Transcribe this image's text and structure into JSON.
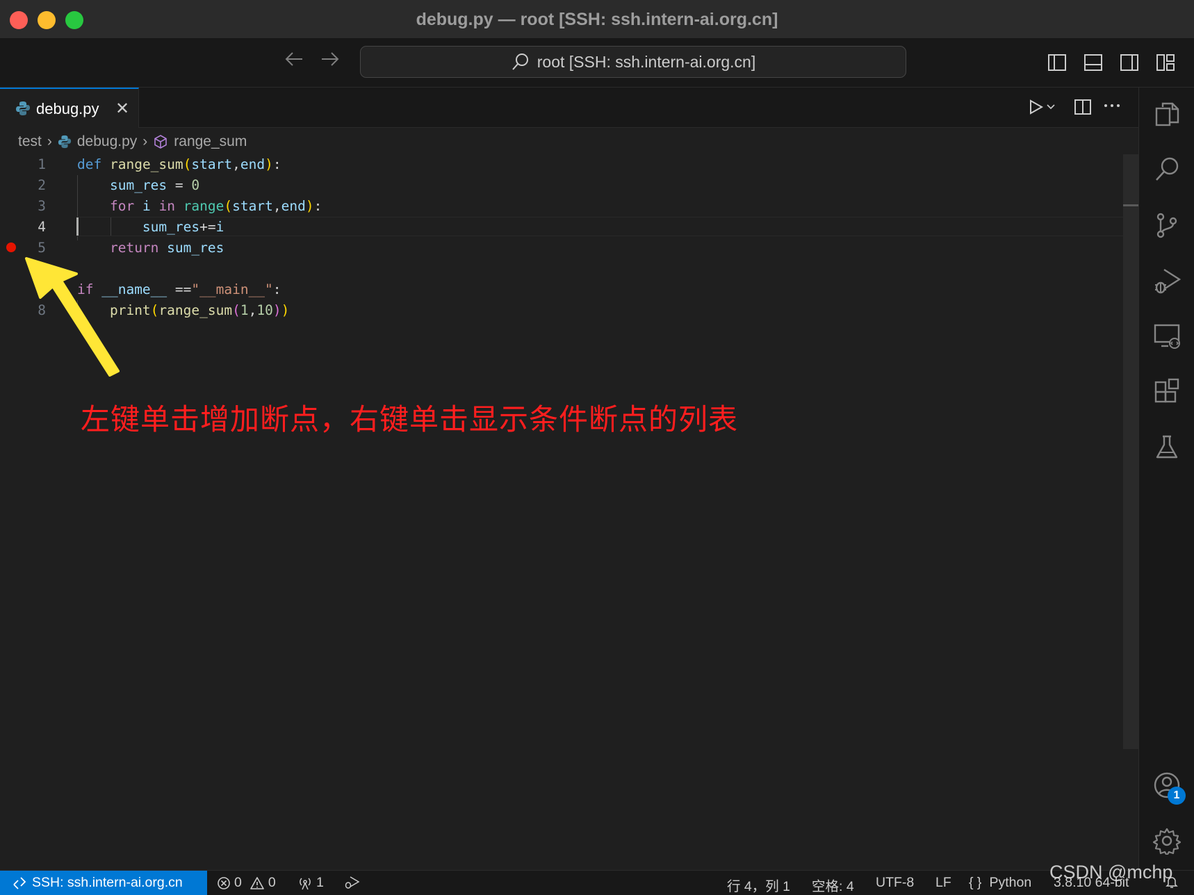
{
  "window": {
    "title": "debug.py — root [SSH: ssh.intern-ai.org.cn]"
  },
  "command_center": {
    "text": "root [SSH: ssh.intern-ai.org.cn]"
  },
  "tab": {
    "label": "debug.py",
    "close": "✕"
  },
  "breadcrumb": {
    "folder": "test",
    "file": "debug.py",
    "symbol": "range_sum",
    "sep": "›"
  },
  "editor": {
    "line_numbers": [
      "1",
      "2",
      "3",
      "4",
      "5",
      "6",
      "7",
      "8"
    ],
    "current_line": "4",
    "breakpoint_line": "5",
    "code": {
      "l1": {
        "def": "def",
        "name": "range_sum",
        "open": "(",
        "a1": "start",
        "comma": ",",
        "a2": "end",
        "close": ")",
        "colon": ":"
      },
      "l2": {
        "var": "sum_res",
        "op": " = ",
        "num": "0"
      },
      "l3": {
        "for": "for",
        "i": "i",
        "in": "in",
        "range": "range",
        "open": "(",
        "a1": "start",
        "comma": ",",
        "a2": "end",
        "close": ")",
        "colon": ":"
      },
      "l4": {
        "var": "sum_res",
        "op": "+=",
        "i": "i"
      },
      "l5": {
        "ret": "return",
        "var": "sum_res"
      },
      "l7": {
        "if": "if",
        "name": "__name__",
        "op": " ==",
        "str": "\"__main__\"",
        "colon": ":"
      },
      "l8": {
        "print": "print",
        "o1": "(",
        "fn": "range_sum",
        "o2": "(",
        "n1": "1",
        "comma": ",",
        "n2": "10",
        "c2": ")",
        "c1": ")"
      }
    }
  },
  "annotation": {
    "text": "左键单击增加断点，右键单击显示条件断点的列表"
  },
  "activity_bar": {
    "icons": [
      "explorer-icon",
      "search-icon",
      "source-control-icon",
      "run-debug-icon",
      "remote-explorer-icon",
      "extensions-icon",
      "testing-icon",
      "account-icon",
      "settings-gear-icon"
    ],
    "account_badge": "1"
  },
  "status_bar": {
    "remote": "SSH: ssh.intern-ai.org.cn",
    "errors": "0",
    "warnings": "0",
    "ports": "1",
    "position": "行 4，列 1",
    "spaces": "空格: 4",
    "encoding": "UTF-8",
    "eol": "LF",
    "language_icon": "{ }",
    "language": "Python",
    "interpreter": "3.8.10 64-bit"
  },
  "watermark": {
    "text": "CSDN @mchp"
  },
  "colors": {
    "accent": "#0078d4",
    "breakpoint": "#e51400",
    "annotation": "#ff1e1e",
    "arrow": "#ffe636"
  }
}
